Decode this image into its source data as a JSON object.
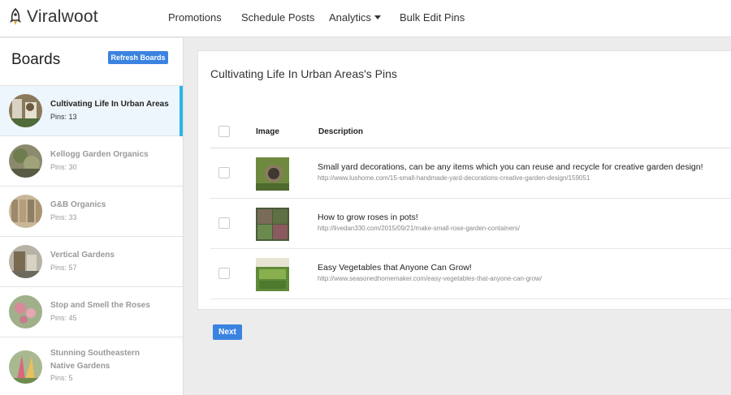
{
  "brand": {
    "name": "Viralwoot",
    "logo_icon": "rocket-icon"
  },
  "nav": {
    "promotions": "Promotions",
    "schedule": "Schedule Posts",
    "analytics": "Analytics",
    "bulk_edit": "Bulk Edit Pins"
  },
  "sidebar": {
    "title": "Boards",
    "refresh_label": "Refresh Boards",
    "boards": [
      {
        "name": "Cultivating Life In Urban Areas",
        "pins": "Pins: 13",
        "active": true
      },
      {
        "name": "Kellogg Garden Organics",
        "pins": "Pins: 30"
      },
      {
        "name": "G&B Organics",
        "pins": "Pins: 33"
      },
      {
        "name": "Vertical Gardens",
        "pins": "Pins: 57"
      },
      {
        "name": "Stop and Smell the Roses",
        "pins": "Pins: 45"
      },
      {
        "name": "Stunning Southeastern Native Gardens",
        "pins": "Pins: 5"
      }
    ]
  },
  "main": {
    "title": "Cultivating Life In Urban Areas's Pins",
    "columns": {
      "image": "Image",
      "description": "Description"
    },
    "pins": [
      {
        "description": "Small yard decorations, can be any items which you can reuse and recycle for creative garden design!",
        "url": "http://www.lushome.com/15-small-handmade-yard-decorations-creative-garden-design/159051"
      },
      {
        "description": "How to grow roses in pots!",
        "url": "http://livedan330.com/2015/09/21/make-small-rose-garden-containers/"
      },
      {
        "description": "Easy Vegetables that Anyone Can Grow!",
        "url": "http://www.seasonedhomemaker.com/easy-vegetables-that-anyone-can-grow/"
      }
    ],
    "next_label": "Next"
  },
  "colors": {
    "accent": "#3b83e0",
    "active_bar": "#29b6e6",
    "active_bg": "#eef6fd"
  }
}
